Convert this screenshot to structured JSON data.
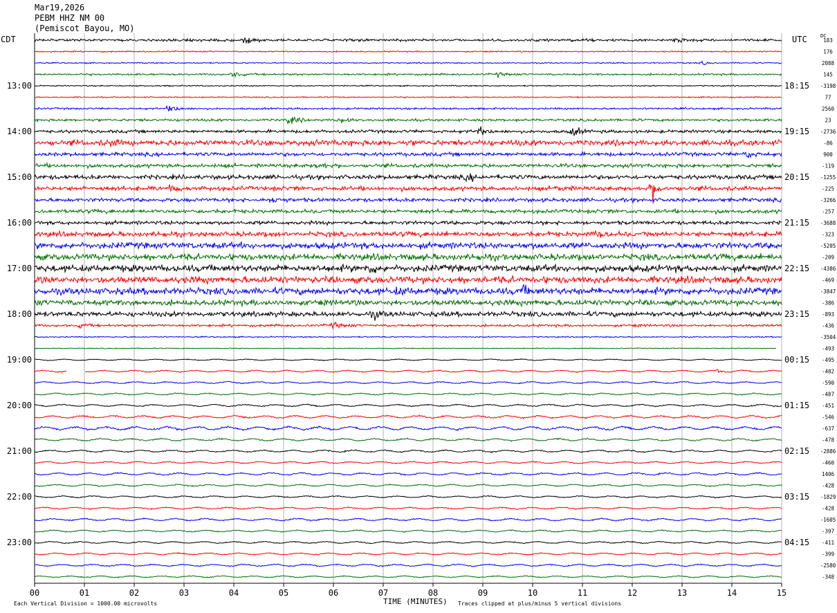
{
  "header": {
    "date": "Mar19,2026",
    "channel": "PEBM HHZ NM 00",
    "station": "(Pemiscot Bayou, MO)"
  },
  "left_zone": "CDT",
  "right_zone": "UTC",
  "dc_label": "DC",
  "footer": {
    "scale_note": "Each Vertical Division = 1000.00 microvolts",
    "clip_note": "Traces clipped at plus/minus 5 vertical divisions"
  },
  "colors": {
    "cycle": [
      "#000000",
      "#ff0000",
      "#0000ff",
      "#007000"
    ],
    "grid": "#808080"
  },
  "chart_data": {
    "type": "line",
    "title": "PEBM HHZ NM 00",
    "xlabel": "TIME (MINUTES)",
    "xlim": [
      0,
      15
    ],
    "x_ticks": [
      "00",
      "01",
      "02",
      "03",
      "04",
      "05",
      "06",
      "07",
      "08",
      "09",
      "10",
      "11",
      "12",
      "13",
      "14",
      "15"
    ],
    "trace_count": 48,
    "left_hour_labels": [
      "13:00",
      "14:00",
      "15:00",
      "16:00",
      "17:00",
      "18:00",
      "19:00",
      "20:00",
      "21:00",
      "22:00",
      "23:00"
    ],
    "right_hour_labels": [
      "18:15",
      "19:15",
      "20:15",
      "21:15",
      "22:15",
      "23:15",
      "00:15",
      "01:15",
      "02:15",
      "03:15",
      "04:15"
    ],
    "hour_label_first_trace": 4,
    "dc_offsets": [
      "183",
      "176",
      "2088",
      "145",
      "-3198",
      "77",
      "2560",
      "23",
      "-2736",
      "-86",
      "900",
      "-119",
      "-1255",
      "-225",
      "-3266",
      "-257",
      "-3688",
      "-323",
      "-5205",
      "-209",
      "-4386",
      "-469",
      "-3847",
      "-386",
      "-893",
      "-436",
      "-3504",
      "-493",
      "-495",
      "-482",
      "-590",
      "-487",
      "-451",
      "-546",
      "-637",
      "-478",
      "-2886",
      "-460",
      "1406",
      "-428",
      "-1829",
      "-428",
      "-1605",
      "-397",
      "-411",
      "-399",
      "-2580",
      "-348"
    ],
    "relative_amplitude": [
      2,
      1,
      1,
      1.5,
      1,
      1,
      1.5,
      2,
      2.5,
      4.5,
      3,
      3,
      3.5,
      3.5,
      3,
      3,
      3,
      4,
      5,
      5,
      5.5,
      5.5,
      5.5,
      4.5,
      4,
      2,
      1,
      0.7,
      0.6,
      0.8,
      0.8,
      0.8,
      0.9,
      1.1,
      1.4,
      1,
      0.9,
      0.8,
      1,
      0.8,
      0.8,
      0.8,
      1,
      0.8,
      0.8,
      0.8,
      0.9,
      0.7
    ],
    "events": [
      {
        "trace": 0,
        "minute": 4.2,
        "amp": 6
      },
      {
        "trace": 0,
        "minute": 12.9,
        "amp": 6
      },
      {
        "trace": 2,
        "minute": 13.4,
        "amp": 3
      },
      {
        "trace": 3,
        "minute": 4.0,
        "amp": 6
      },
      {
        "trace": 3,
        "minute": 9.3,
        "amp": 4
      },
      {
        "trace": 6,
        "minute": 2.7,
        "amp": 8
      },
      {
        "trace": 7,
        "minute": 5.1,
        "amp": 10
      },
      {
        "trace": 7,
        "minute": 6.1,
        "amp": 6
      },
      {
        "trace": 8,
        "minute": 8.9,
        "amp": 8
      },
      {
        "trace": 8,
        "minute": 10.8,
        "amp": 9
      },
      {
        "trace": 9,
        "minute": 1.5,
        "amp": 5
      },
      {
        "trace": 10,
        "minute": 14.3,
        "amp": 6
      },
      {
        "trace": 11,
        "minute": 5.7,
        "amp": 7
      },
      {
        "trace": 12,
        "minute": 8.7,
        "amp": 6
      },
      {
        "trace": 13,
        "minute": 12.4,
        "amp": 18
      },
      {
        "trace": 13,
        "minute": 2.7,
        "amp": 5
      },
      {
        "trace": 13,
        "minute": 10.5,
        "amp": 5
      },
      {
        "trace": 14,
        "minute": 4.8,
        "amp": 7
      },
      {
        "trace": 17,
        "minute": 11.3,
        "amp": 5
      },
      {
        "trace": 20,
        "minute": 6.7,
        "amp": 8
      },
      {
        "trace": 22,
        "minute": 7.3,
        "amp": 6
      },
      {
        "trace": 22,
        "minute": 9.8,
        "amp": 6
      },
      {
        "trace": 24,
        "minute": 6.8,
        "amp": 6
      },
      {
        "trace": 25,
        "minute": 6.0,
        "amp": 6
      },
      {
        "trace": 25,
        "minute": 0.9,
        "amp": 4
      },
      {
        "trace": 29,
        "minute": 13.7,
        "amp": 3
      }
    ],
    "gaps": [
      {
        "trace": 29,
        "from": 0.65,
        "to": 1.0
      }
    ],
    "trace_ends": [
      {
        "trace": 27,
        "end": 14.9
      }
    ]
  }
}
